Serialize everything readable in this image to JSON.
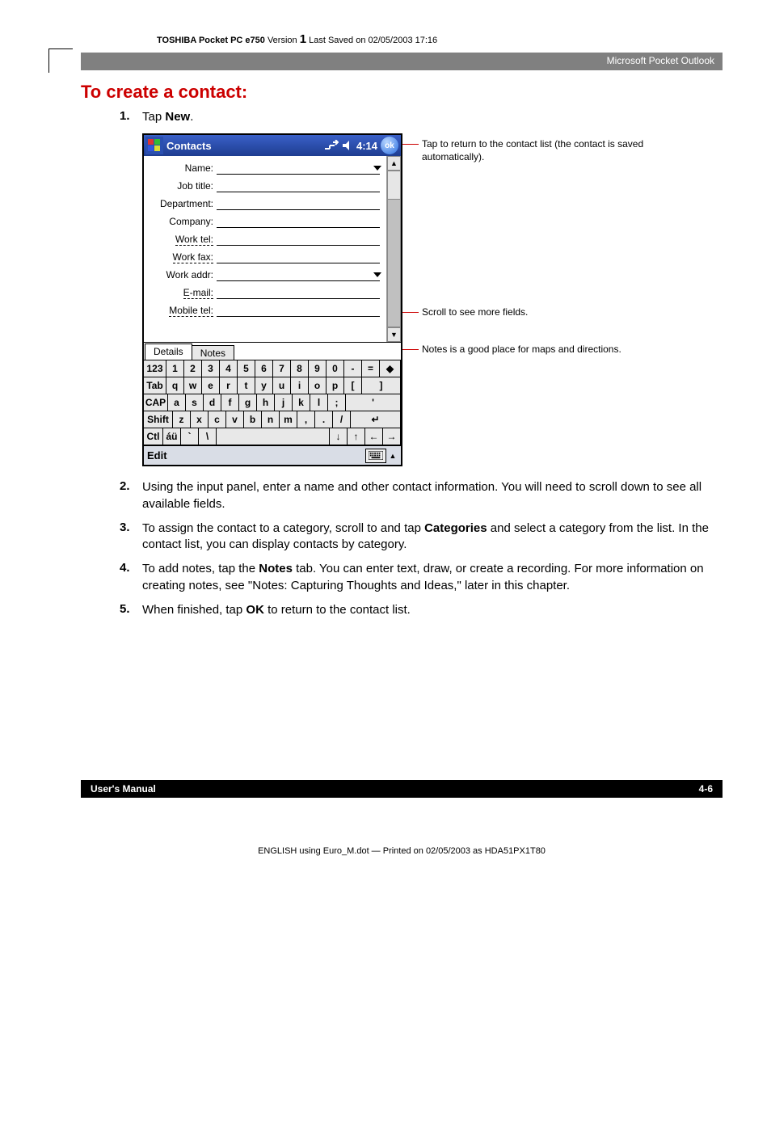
{
  "running_header": {
    "prefix": "TOSHIBA Pocket PC e750",
    "version_label": "Version",
    "version_num": "1",
    "suffix": "Last Saved on 02/05/2003 17:16"
  },
  "chapter_header": "Microsoft Pocket Outlook",
  "section_title": "To create a contact:",
  "steps": {
    "s1_num": "1.",
    "s1_a": "Tap ",
    "s1_b": "New",
    "s1_c": ".",
    "s2_num": "2.",
    "s2": "Using the input panel, enter a name and other contact information. You will need to scroll down to see all available fields.",
    "s3_num": "3.",
    "s3_a": "To assign the contact to a category, scroll to and tap ",
    "s3_b": "Categories",
    "s3_c": " and select a category from the list. In the contact list, you can display contacts by category.",
    "s4_num": "4.",
    "s4_a": "To add notes, tap the ",
    "s4_b": "Notes",
    "s4_c": " tab. You can enter text, draw, or create a recording. For more information on creating notes, see \"Notes: Capturing Thoughts and Ideas,\" later in this chapter.",
    "s5_num": "5.",
    "s5_a": "When finished, tap ",
    "s5_b": "OK",
    "s5_c": " to return to the contact list."
  },
  "device": {
    "titlebar": {
      "app_name": "Contacts",
      "clock": "4:14",
      "ok": "ok"
    },
    "fields": {
      "name": "Name:",
      "job_title": "Job title:",
      "department": "Department:",
      "company": "Company:",
      "work_tel": "Work tel:",
      "work_fax": "Work fax:",
      "work_addr": "Work addr:",
      "email": "E-mail:",
      "mobile_tel": "Mobile tel:"
    },
    "tabs": {
      "details": "Details",
      "notes": "Notes"
    },
    "keyboard": {
      "r1": [
        "123",
        "1",
        "2",
        "3",
        "4",
        "5",
        "6",
        "7",
        "8",
        "9",
        "0",
        "-",
        "=",
        "◆"
      ],
      "r2": [
        "Tab",
        "q",
        "w",
        "e",
        "r",
        "t",
        "y",
        "u",
        "i",
        "o",
        "p",
        "[",
        "]"
      ],
      "r3": [
        "CAP",
        "a",
        "s",
        "d",
        "f",
        "g",
        "h",
        "j",
        "k",
        "l",
        ";",
        "'"
      ],
      "r4": [
        "Shift",
        "z",
        "x",
        "c",
        "v",
        "b",
        "n",
        "m",
        ",",
        ".",
        "/",
        "↵"
      ],
      "r5": [
        "Ctl",
        "áü",
        "`",
        "\\",
        " ",
        "↓",
        "↑",
        "←",
        "→"
      ]
    },
    "bottombar": {
      "edit": "Edit"
    }
  },
  "callouts": {
    "c1": "Tap to return to the contact list (the contact is saved automatically).",
    "c2": "Scroll to see more fields.",
    "c3": "Notes is a good place for maps and directions."
  },
  "footer": {
    "left": "User's Manual",
    "right": "4-6"
  },
  "print_line": "ENGLISH using Euro_M.dot — Printed on 02/05/2003 as HDA51PX1T80"
}
